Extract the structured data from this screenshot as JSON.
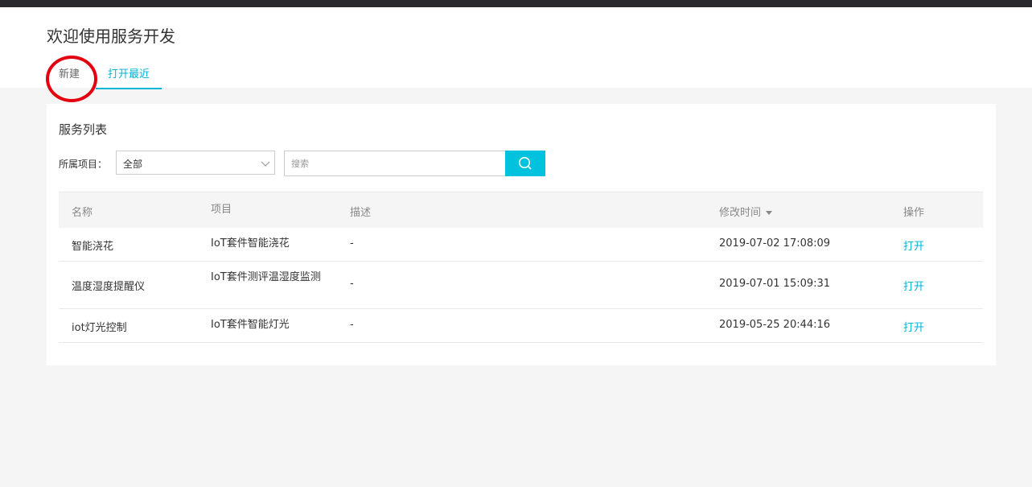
{
  "header": {
    "title": "欢迎使用服务开发",
    "tabs": [
      {
        "label": "新建"
      },
      {
        "label": "打开最近"
      }
    ]
  },
  "card": {
    "section_title": "服务列表",
    "filter": {
      "label": "所属项目：",
      "selected": "全部",
      "search_placeholder": "搜索"
    },
    "table": {
      "columns": [
        "名称",
        "项目",
        "描述",
        "修改时间",
        "操作"
      ],
      "rows": [
        {
          "name": "智能浇花",
          "project": "IoT套件智能浇花",
          "description": "-",
          "modified": "2019-07-02 17:08:09",
          "action": "打开"
        },
        {
          "name": "温度湿度提醒仪",
          "project": "IoT套件测评温湿度监测",
          "description": "-",
          "modified": "2019-07-01 15:09:31",
          "action": "打开"
        },
        {
          "name": "iot灯光控制",
          "project": "IoT套件智能灯光",
          "description": "-",
          "modified": "2019-05-25 20:44:16",
          "action": "打开"
        }
      ]
    }
  },
  "colors": {
    "accent": "#00c1de",
    "link": "#00b4d8",
    "annotation": "#e3000f",
    "topbar": "#2a2a2e"
  }
}
